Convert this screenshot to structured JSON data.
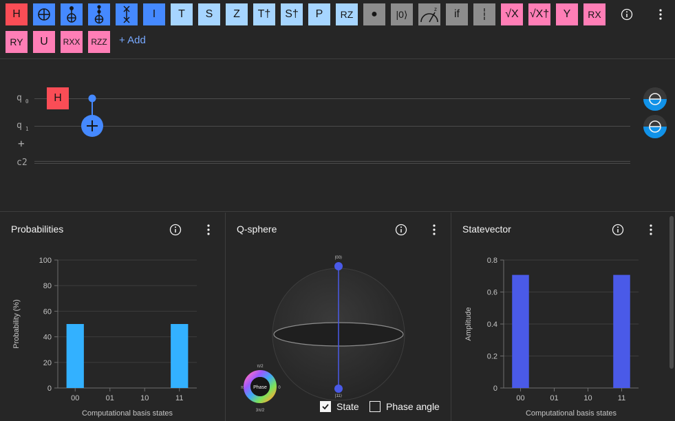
{
  "palette": {
    "gates": [
      {
        "id": "h",
        "label": "H",
        "color": "red"
      },
      {
        "id": "cnot",
        "label": "⊕",
        "color": "blue"
      },
      {
        "id": "toffoli",
        "label": "",
        "color": "blue"
      },
      {
        "id": "ccx",
        "label": "",
        "color": "blue"
      },
      {
        "id": "swap",
        "label": "",
        "color": "blue"
      },
      {
        "id": "i",
        "label": "I",
        "color": "blue"
      },
      {
        "id": "t",
        "label": "T",
        "color": "lightblue"
      },
      {
        "id": "s",
        "label": "S",
        "color": "lightblue"
      },
      {
        "id": "z",
        "label": "Z",
        "color": "lightblue"
      },
      {
        "id": "tdg",
        "label": "T†",
        "color": "lightblue"
      },
      {
        "id": "sdg",
        "label": "S†",
        "color": "lightblue"
      },
      {
        "id": "p",
        "label": "P",
        "color": "lightblue"
      },
      {
        "id": "rz",
        "label": "RZ",
        "color": "lightblue"
      },
      {
        "id": "barrier-dot",
        "label": "●",
        "color": "gray"
      },
      {
        "id": "reset",
        "label": "|0⟩",
        "color": "gray"
      },
      {
        "id": "measure",
        "label": "",
        "color": "gray"
      },
      {
        "id": "if",
        "label": "if",
        "color": "gray"
      },
      {
        "id": "barrier",
        "label": "┆",
        "color": "gray"
      },
      {
        "id": "sx",
        "label": "√X",
        "color": "pink"
      },
      {
        "id": "sxdg",
        "label": "√X†",
        "color": "pink"
      },
      {
        "id": "y",
        "label": "Y",
        "color": "pink"
      },
      {
        "id": "rx",
        "label": "RX",
        "color": "pink"
      },
      {
        "id": "ry",
        "label": "RY",
        "color": "pink"
      },
      {
        "id": "u",
        "label": "U",
        "color": "pink"
      },
      {
        "id": "rxx",
        "label": "RXX",
        "color": "pink"
      },
      {
        "id": "rzz",
        "label": "RZZ",
        "color": "pink"
      }
    ],
    "add_label": "+ Add"
  },
  "circuit": {
    "qubits": [
      {
        "name": "q",
        "index": "0"
      },
      {
        "name": "q",
        "index": "1"
      }
    ],
    "add_qubit": "+",
    "classical": "c2",
    "h_gate": "H"
  },
  "probabilities": {
    "title": "Probabilities",
    "chart_data": {
      "type": "bar",
      "categories": [
        "00",
        "01",
        "10",
        "11"
      ],
      "values": [
        50,
        0,
        0,
        50
      ],
      "ylabel": "Probability (%)",
      "xlabel": "Computational basis states",
      "ylim": [
        0,
        100
      ],
      "yticks": [
        0,
        20,
        40,
        60,
        80,
        100
      ],
      "bar_color": "#33b1ff"
    }
  },
  "qsphere": {
    "title": "Q-sphere",
    "top_state": "|00⟩",
    "bottom_state": "|11⟩",
    "phase_label": "Phase",
    "phase_ticks": {
      "top": "π/2",
      "left": "π",
      "right": "0",
      "bottom": "3π/2"
    },
    "state_label": "State",
    "phase_angle_label": "Phase angle",
    "state_checked": true,
    "phase_angle_checked": false
  },
  "statevector": {
    "title": "Statevector",
    "chart_data": {
      "type": "bar",
      "categories": [
        "00",
        "01",
        "10",
        "11"
      ],
      "values": [
        0.707,
        0,
        0,
        0.707
      ],
      "ylabel": "Amplitude",
      "xlabel": "Computational basis states",
      "ylim": [
        0,
        0.8
      ],
      "yticks": [
        0,
        0.2,
        0.4,
        0.6,
        0.8
      ],
      "bar_color": "#4a5ae8"
    }
  }
}
